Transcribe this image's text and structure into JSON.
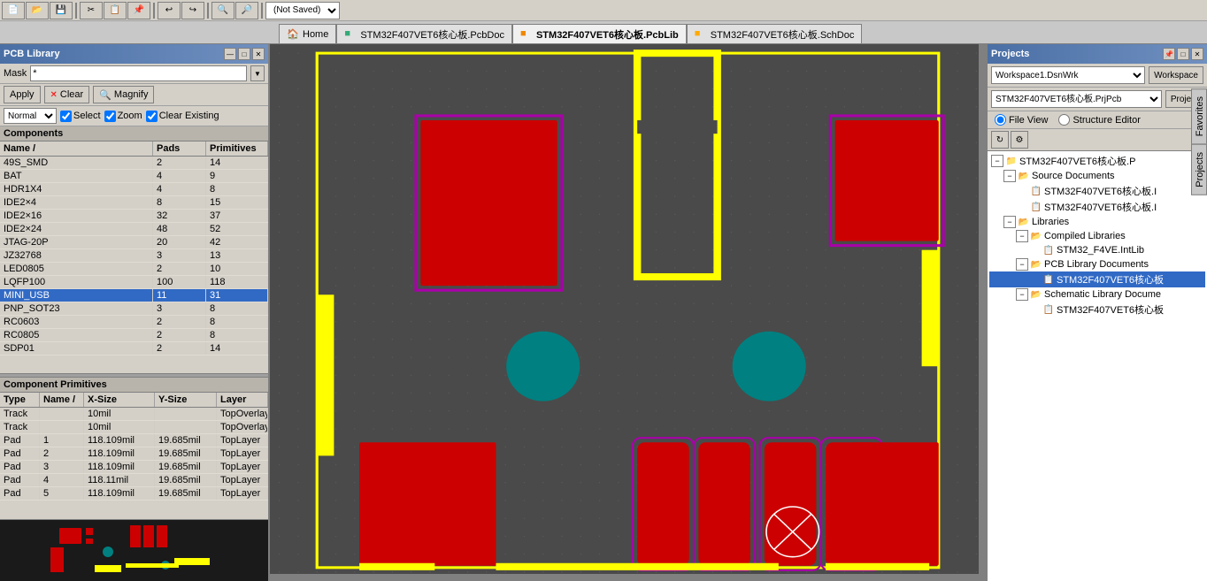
{
  "toolbar": {
    "title": "PCB Library",
    "file_selector": "(Not Saved)",
    "buttons": [
      "new",
      "open",
      "save",
      "print",
      "undo",
      "redo",
      "zoom_in",
      "zoom_out",
      "fit"
    ]
  },
  "tabs": [
    {
      "label": "Home",
      "icon": "🏠",
      "active": false
    },
    {
      "label": "STM32F407VET6核心板.PcbDoc",
      "icon": "📋",
      "active": false
    },
    {
      "label": "STM32F407VET6核心板.PcbLib",
      "icon": "📋",
      "active": true
    },
    {
      "label": "STM32F407VET6核心板.SchDoc",
      "icon": "📄",
      "active": false
    }
  ],
  "left_panel": {
    "title": "PCB Library",
    "mask_label": "Mask",
    "mask_value": "*",
    "apply_label": "Apply",
    "clear_label": "Clear",
    "magnify_label": "Magnify",
    "normal_value": "Normal",
    "select_label": "Select",
    "zoom_label": "Zoom",
    "clear_existing_label": "Clear Existing",
    "components_label": "Components",
    "columns": [
      "Name",
      "Pads",
      "Primitives"
    ],
    "sort_indicator": "/",
    "components": [
      {
        "name": "49S_SMD",
        "pads": "2",
        "primitives": "14"
      },
      {
        "name": "BAT",
        "pads": "4",
        "primitives": "9"
      },
      {
        "name": "HDR1X4",
        "pads": "4",
        "primitives": "8"
      },
      {
        "name": "IDE2×4",
        "pads": "8",
        "primitives": "15"
      },
      {
        "name": "IDE2×16",
        "pads": "32",
        "primitives": "37"
      },
      {
        "name": "IDE2×24",
        "pads": "48",
        "primitives": "52"
      },
      {
        "name": "JTAG-20P",
        "pads": "20",
        "primitives": "42"
      },
      {
        "name": "JZ32768",
        "pads": "3",
        "primitives": "13"
      },
      {
        "name": "LED0805",
        "pads": "2",
        "primitives": "10"
      },
      {
        "name": "LQFP100",
        "pads": "100",
        "primitives": "118"
      },
      {
        "name": "MINI_USB",
        "pads": "11",
        "primitives": "31",
        "selected": true
      },
      {
        "name": "PNP_SOT23",
        "pads": "3",
        "primitives": "8"
      },
      {
        "name": "RC0603",
        "pads": "2",
        "primitives": "8"
      },
      {
        "name": "RC0805",
        "pads": "2",
        "primitives": "8"
      },
      {
        "name": "SDP01",
        "pads": "2",
        "primitives": "14"
      }
    ],
    "primitives_label": "Component Primitives",
    "prim_columns": [
      "Type",
      "Name",
      "X-Size",
      "Y-Size",
      "Layer"
    ],
    "primitives": [
      {
        "type": "Track",
        "name": "",
        "x_size": "10mil",
        "y_size": "",
        "layer": "TopOverlay"
      },
      {
        "type": "Track",
        "name": "",
        "x_size": "10mil",
        "y_size": "",
        "layer": "TopOverlay"
      },
      {
        "type": "Pad",
        "name": "1",
        "x_size": "118.109mil",
        "y_size": "19.685mil",
        "layer": "TopLayer"
      },
      {
        "type": "Pad",
        "name": "2",
        "x_size": "118.109mil",
        "y_size": "19.685mil",
        "layer": "TopLayer"
      },
      {
        "type": "Pad",
        "name": "3",
        "x_size": "118.109mil",
        "y_size": "19.685mil",
        "layer": "TopLayer"
      },
      {
        "type": "Pad",
        "name": "4",
        "x_size": "118.11mil",
        "y_size": "19.685mil",
        "layer": "TopLayer"
      },
      {
        "type": "Pad",
        "name": "5",
        "x_size": "118.109mil",
        "y_size": "19.685mil",
        "layer": "TopLayer"
      }
    ]
  },
  "right_panel": {
    "title": "Projects",
    "workspace_label": "Workspace",
    "workspace_value": "Workspace1.DsnWrk",
    "project_label": "Project",
    "project_value": "STM32F407VET6核心板.PrjPcb",
    "file_view_label": "File View",
    "structure_editor_label": "Structure Editor",
    "tree": [
      {
        "label": "STM32F407VET6核心板.P",
        "type": "project",
        "icon": "📁",
        "expanded": true,
        "children": [
          {
            "label": "Source Documents",
            "type": "folder",
            "icon": "📂",
            "expanded": true,
            "children": [
              {
                "label": "STM32F407VET6核心板.I",
                "type": "file",
                "icon": "📋"
              },
              {
                "label": "STM32F407VET6核心板.I",
                "type": "file",
                "icon": "📋"
              }
            ]
          },
          {
            "label": "Libraries",
            "type": "folder",
            "icon": "📂",
            "expanded": true,
            "children": [
              {
                "label": "Compiled Libraries",
                "type": "folder",
                "icon": "📂",
                "expanded": true,
                "children": [
                  {
                    "label": "STM32_F4VE.IntLib",
                    "type": "file",
                    "icon": "📋"
                  }
                ]
              },
              {
                "label": "PCB Library Documents",
                "type": "folder",
                "icon": "📂",
                "expanded": true,
                "children": [
                  {
                    "label": "STM32F407VET6核心板",
                    "type": "file",
                    "icon": "📋",
                    "selected": true
                  }
                ]
              },
              {
                "label": "Schematic Library Docume",
                "type": "folder",
                "icon": "📂",
                "expanded": true,
                "children": [
                  {
                    "label": "STM32F407VET6核心板",
                    "type": "file",
                    "icon": "📋"
                  }
                ]
              }
            ]
          }
        ]
      }
    ]
  },
  "side_tabs": [
    "Favorites",
    "Projects"
  ],
  "canvas": {
    "background": "#4a4a4a",
    "grid_color": "#555555"
  }
}
